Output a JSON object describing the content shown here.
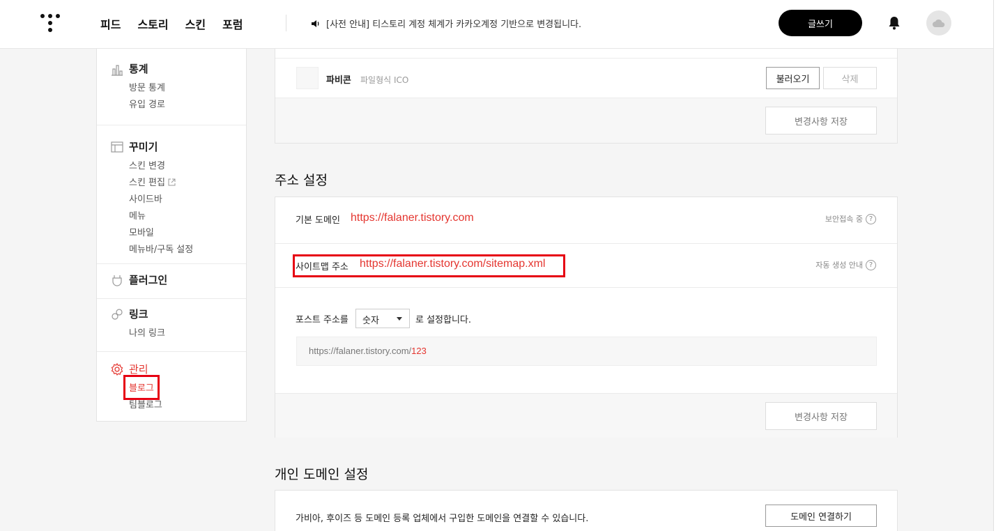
{
  "header": {
    "nav": [
      "피드",
      "스토리",
      "스킨",
      "포럼"
    ],
    "notice": "[사전 안내] 티스토리 계정 체계가 카카오계정 기반으로 변경됩니다.",
    "write_label": "글쓰기"
  },
  "sidebar": {
    "stats": {
      "title": "통계",
      "items": [
        "방문 통계",
        "유입 경로"
      ]
    },
    "decorate": {
      "title": "꾸미기",
      "items": [
        "스킨 변경",
        "스킨 편집",
        "사이드바",
        "메뉴",
        "모바일",
        "메뉴바/구독 설정"
      ]
    },
    "plugin": {
      "title": "플러그인"
    },
    "link": {
      "title": "링크",
      "items": [
        "나의 링크"
      ]
    },
    "manage": {
      "title": "관리",
      "items": [
        "블로그",
        "팀블로그"
      ]
    }
  },
  "favicon": {
    "label": "파비콘",
    "desc": "파일형식 ICO",
    "load_label": "불러오기",
    "delete_label": "삭제",
    "save_label": "변경사항 저장"
  },
  "address": {
    "title": "주소 설정",
    "domain_label": "기본 도메인",
    "domain_url": "https://falaner.tistory.com",
    "domain_help": "보안접속 중",
    "sitemap_label": "사이트맵 주소",
    "sitemap_url": "https://falaner.tistory.com/sitemap.xml",
    "sitemap_help": "자동 생성 안내",
    "post_prefix": "포스트 주소를",
    "post_select": "숫자",
    "post_suffix": "로 설정합니다.",
    "preview_base": "https://falaner.tistory.com/",
    "preview_num": "123",
    "save_label": "변경사항 저장"
  },
  "custom_domain": {
    "title": "개인 도메인 설정",
    "desc": "가비아, 후이즈 등 도메인 등록 업체에서 구입한 도메인을 연결할 수 있습니다.",
    "connect_label": "도메인 연결하기"
  },
  "colors": {
    "accent": "#e4352f",
    "highlight": "#e60012"
  }
}
